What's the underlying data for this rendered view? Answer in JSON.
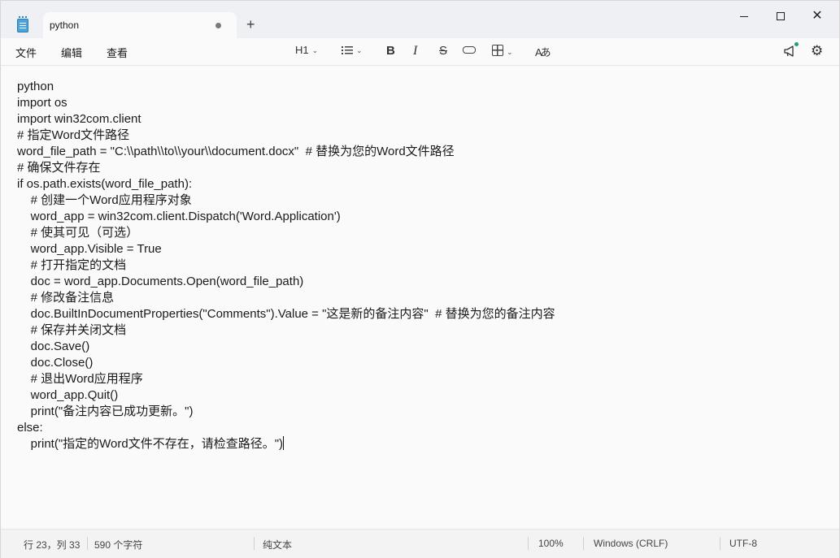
{
  "app": {
    "tab_title": "python",
    "new_tab_symbol": "+",
    "close_symbol": "✕"
  },
  "menu": {
    "file": "文件",
    "edit": "编辑",
    "view": "查看"
  },
  "toolbar": {
    "heading": "H1",
    "bold": "B",
    "italic": "I",
    "strike": "S",
    "spell": "Aあ"
  },
  "editor": {
    "lines": [
      "python",
      "import os",
      "import win32com.client",
      "# 指定Word文件路径",
      "word_file_path = \"C:\\\\path\\\\to\\\\your\\\\document.docx\"  # 替换为您的Word文件路径",
      "# 确保文件存在",
      "if os.path.exists(word_file_path):",
      "    # 创建一个Word应用程序对象",
      "    word_app = win32com.client.Dispatch('Word.Application')",
      "    # 使其可见（可选）",
      "    word_app.Visible = True",
      "    # 打开指定的文档",
      "    doc = word_app.Documents.Open(word_file_path)",
      "    # 修改备注信息",
      "    doc.BuiltInDocumentProperties(\"Comments\").Value = \"这是新的备注内容\"  # 替换为您的备注内容",
      "    # 保存并关闭文档",
      "    doc.Save()",
      "    doc.Close()",
      "    # 退出Word应用程序",
      "    word_app.Quit()",
      "    print(\"备注内容已成功更新。\")",
      "else:",
      "    print(\"指定的Word文件不存在，请检查路径。\")"
    ]
  },
  "status": {
    "position": "行 23，列 33",
    "char_count": "590 个字符",
    "format": "纯文本",
    "zoom": "100%",
    "line_ending": "Windows (CRLF)",
    "encoding": "UTF-8"
  }
}
